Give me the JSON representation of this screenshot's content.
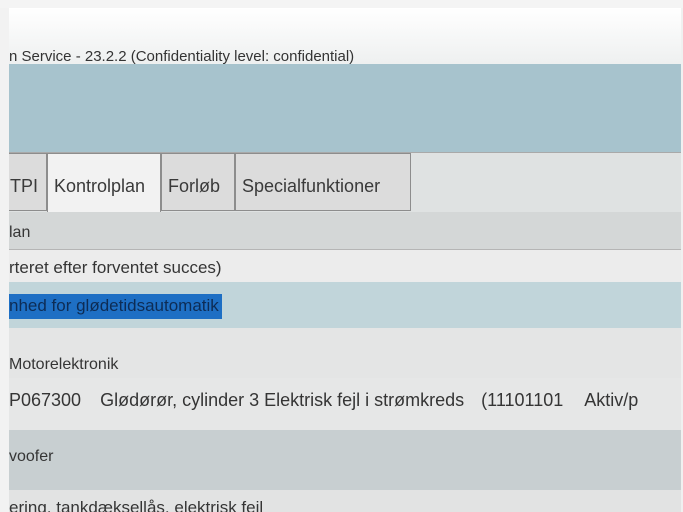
{
  "window": {
    "title": "n Service - 23.2.2 (Confidentiality level: confidential)"
  },
  "tabs": [
    {
      "label": "TPI"
    },
    {
      "label": "Kontrolplan"
    },
    {
      "label": "Forløb"
    },
    {
      "label": "Specialfunktioner"
    }
  ],
  "section": {
    "plan_label": "lan",
    "sort_note": "rteret efter forventet succes)"
  },
  "selected_item": {
    "label": "nhed for glødetidsautomatik"
  },
  "module": {
    "label": "Motorelektronik"
  },
  "fault": {
    "code": "P067300",
    "description": "Glødørør, cylinder 3 Elektrisk fejl i strømkreds",
    "status_code": "(11101101",
    "status": "Aktiv/p"
  },
  "woofer": {
    "label": "voofer"
  },
  "tank": {
    "label": "ering, tankdæksellås, elektrisk fejl"
  }
}
